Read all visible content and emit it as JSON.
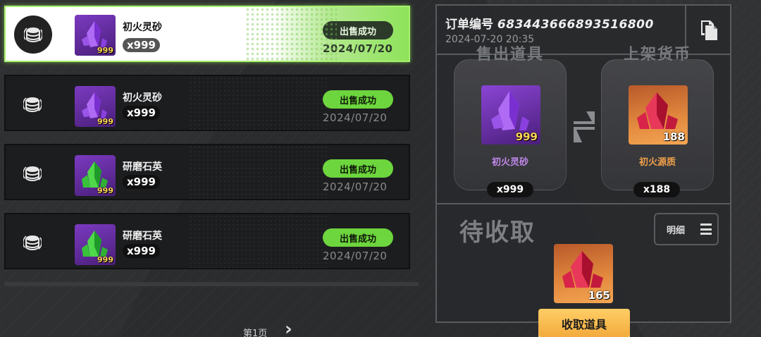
{
  "sale_records": [
    {
      "item_name": "初火灵砂",
      "count": "x999",
      "badge_qty": "999",
      "status": "出售成功",
      "date": "2024/07/20",
      "item_color": "purple"
    },
    {
      "item_name": "初火灵砂",
      "count": "x999",
      "badge_qty": "999",
      "status": "出售成功",
      "date": "2024/07/20",
      "item_color": "purple"
    },
    {
      "item_name": "研磨石英",
      "count": "x999",
      "badge_qty": "999",
      "status": "出售成功",
      "date": "2024/07/20",
      "item_color": "green"
    },
    {
      "item_name": "研磨石英",
      "count": "x999",
      "badge_qty": "999",
      "status": "出售成功",
      "date": "2024/07/20",
      "item_color": "green"
    }
  ],
  "pagination": {
    "page_label": "第1页",
    "next_icon": "chevron-right-icon"
  },
  "order": {
    "label": "订单编号",
    "number": "683443666893516800",
    "time": "2024-07-20 20:35",
    "copy_icon": "copy-icon"
  },
  "trade": {
    "sold": {
      "heading": "售出道具",
      "item_name": "初火灵砂",
      "badge_qty": "999",
      "count": "x999",
      "name_color": "#c58af0"
    },
    "currency": {
      "heading": "上架货币",
      "item_name": "初火源质",
      "badge_qty": "188",
      "count": "x188",
      "name_color": "#f0a04a"
    },
    "swap_icon": "swap-arrows-icon"
  },
  "pending": {
    "title": "待收取",
    "detail_label": "明细",
    "reward_qty": "165",
    "claim_label": "收取道具"
  },
  "colors": {
    "success_green": "#6dd53d",
    "active_border": "#a8f06e",
    "claim_orange": "#f2a93a",
    "rarity_purple": "#7b3ac0",
    "rarity_orange": "#e38a3f"
  }
}
